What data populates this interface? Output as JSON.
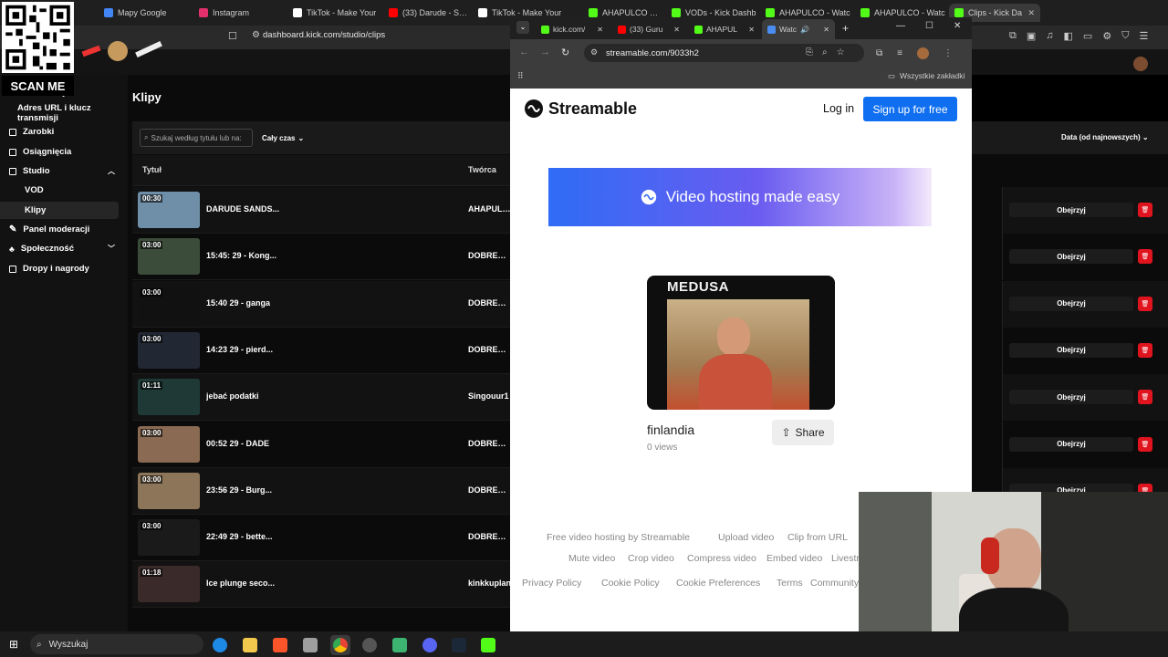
{
  "back_browser": {
    "tabs": [
      {
        "label": "Mapy Google",
        "color": "#4285f4"
      },
      {
        "label": "Instagram",
        "color": "#e1306c"
      },
      {
        "label": "TikTok - Make Your",
        "color": "#ffffff"
      },
      {
        "label": "(33) Darude - Sand",
        "color": "#ff0000"
      },
      {
        "label": "TikTok - Make Your",
        "color": "#ffffff"
      },
      {
        "label": "AHAPULCO Stream",
        "color": "#53fc18"
      },
      {
        "label": "VODs - Kick Dashb",
        "color": "#53fc18"
      },
      {
        "label": "AHAPULCO - Watc",
        "color": "#53fc18"
      },
      {
        "label": "AHAPULCO - Watc",
        "color": "#53fc18"
      },
      {
        "label": "Clips - Kick Da",
        "color": "#53fc18"
      }
    ],
    "url": "dashboard.kick.com/studio/clips"
  },
  "sidebar": {
    "items": [
      {
        "label": "Transmisje"
      },
      {
        "label": "Adres URL i klucz transmisji"
      },
      {
        "label": "Zarobki"
      },
      {
        "label": "Osiągnięcia"
      },
      {
        "label": "Studio"
      },
      {
        "label": "VOD"
      },
      {
        "label": "Klipy"
      },
      {
        "label": "Panel moderacji"
      },
      {
        "label": "Społeczność"
      },
      {
        "label": "Dropy i nagrody"
      }
    ]
  },
  "main": {
    "title": "Klipy",
    "search_placeholder": "Szukaj według tytułu lub na:",
    "period": "Cały czas",
    "sort": "Data (od najnowszych)",
    "columns": {
      "title": "Tytuł",
      "creator": "Twórca"
    },
    "watch_label": "Obejrzyj",
    "clips": [
      {
        "duration": "00:30",
        "title": "DARUDE SANDS...",
        "creator": "AHAPULCO"
      },
      {
        "duration": "03:00",
        "title": "15:45: 29 - Kong...",
        "creator": "DOBREWAI"
      },
      {
        "duration": "03:00",
        "title": "15:40 29 - ganga",
        "creator": "DOBREWAI"
      },
      {
        "duration": "03:00",
        "title": "14:23 29 - pierd...",
        "creator": "DOBREWAI"
      },
      {
        "duration": "01:11",
        "title": "jebać podatki",
        "creator": "Singouur1"
      },
      {
        "duration": "03:00",
        "title": "00:52 29 - DADE",
        "creator": "DOBREWAI"
      },
      {
        "duration": "03:00",
        "title": "23:56 29 - Burg...",
        "creator": "DOBREWAI"
      },
      {
        "duration": "03:00",
        "title": "22:49 29 - bette...",
        "creator": "DOBREWAI"
      },
      {
        "duration": "01:18",
        "title": "Ice plunge seco...",
        "creator": "kinkkuplan"
      }
    ]
  },
  "front_window": {
    "tabs": [
      {
        "label": "kick.com/",
        "color": "#53fc18"
      },
      {
        "label": "(33) Guru",
        "color": "#ff0000"
      },
      {
        "label": "AHAPUL",
        "color": "#53fc18"
      },
      {
        "label": "Watc",
        "color": "#4a8df0"
      }
    ],
    "url": "streamable.com/9033h2",
    "bookmarks_label": "Wszystkie zakładki"
  },
  "streamable": {
    "brand": "Streamable",
    "login": "Log in",
    "signup": "Sign up for free",
    "banner": "Video hosting made easy",
    "video_caption": "MEDUSA",
    "video_title": "finlandia",
    "views": "0 views",
    "share": "Share",
    "footer_links": [
      [
        "Free video hosting by Streamable",
        "Upload video",
        "Clip from URL",
        "Trim vid"
      ],
      [
        "Mute video",
        "Crop video",
        "Compress video",
        "Embed video",
        "Livestre"
      ],
      [
        "Privacy Policy",
        "Cookie Policy",
        "Cookie Preferences",
        "Terms",
        "Community Guide"
      ]
    ]
  },
  "overlay": {
    "qr_caption": "SCAN ME"
  },
  "taskbar": {
    "search": "Wyszukaj"
  }
}
